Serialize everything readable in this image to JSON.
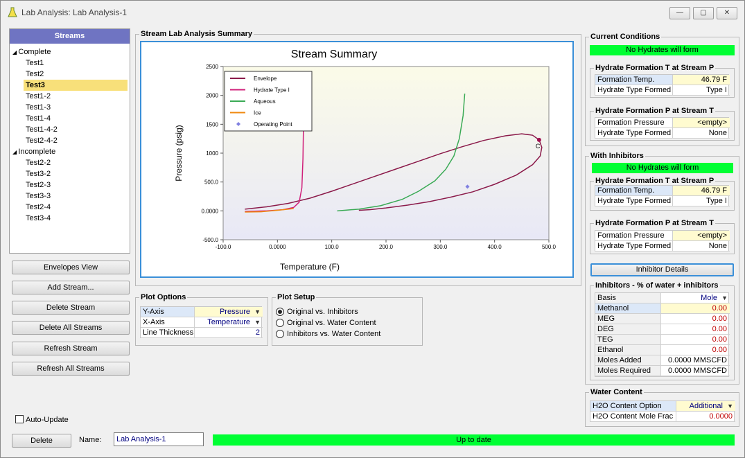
{
  "window": {
    "title": "Lab Analysis: Lab Analysis-1",
    "min_btn": "—",
    "max_btn": "▢",
    "close_btn": "✕"
  },
  "streams": {
    "header": "Streams",
    "groups": [
      {
        "label": "Complete",
        "items": [
          "Test1",
          "Test2",
          "Test3",
          "Test1-2",
          "Test1-3",
          "Test1-4",
          "Test1-4-2",
          "Test2-4-2"
        ]
      },
      {
        "label": "Incomplete",
        "items": [
          "Test2-2",
          "Test3-2",
          "Test2-3",
          "Test3-3",
          "Test2-4",
          "Test3-4"
        ]
      }
    ],
    "selected": "Test3"
  },
  "buttons": {
    "envelopes_view": "Envelopes View",
    "add_stream": "Add Stream...",
    "delete_stream": "Delete Stream",
    "delete_all_streams": "Delete All Streams",
    "refresh_stream": "Refresh Stream",
    "refresh_all_streams": "Refresh All Streams",
    "delete": "Delete",
    "inhibitor_details": "Inhibitor Details"
  },
  "auto_update": {
    "label": "Auto-Update",
    "checked": false
  },
  "name_field": {
    "label": "Name:",
    "value": "Lab Analysis-1"
  },
  "status_bar": "Up to date",
  "summary": {
    "group_title": "Stream Lab Analysis Summary"
  },
  "chart_data": {
    "type": "line",
    "title": "Stream Summary",
    "xlabel": "Temperature (F)",
    "ylabel": "Pressure (psig)",
    "xlim": [
      -100,
      500
    ],
    "ylim": [
      -500,
      2500
    ],
    "x_ticks": [
      "-100.0",
      "0.0000",
      "100.0",
      "200.0",
      "300.0",
      "400.0",
      "500.0"
    ],
    "y_ticks": [
      "-500.0",
      "0.0000",
      "500.0",
      "1000",
      "1500",
      "2000",
      "2500"
    ],
    "legend_position": "top-left",
    "series": [
      {
        "name": "Envelope",
        "color": "#8b1a4a",
        "x": [
          -60,
          -20,
          20,
          60,
          100,
          140,
          180,
          220,
          260,
          300,
          340,
          380,
          420,
          450,
          470,
          482,
          487,
          484,
          470,
          440,
          400,
          360,
          320,
          280,
          240,
          200,
          170,
          150
        ],
        "y": [
          30,
          70,
          130,
          220,
          340,
          470,
          600,
          730,
          860,
          990,
          1110,
          1220,
          1300,
          1335,
          1310,
          1230,
          1100,
          950,
          800,
          620,
          460,
          330,
          240,
          160,
          100,
          50,
          20,
          10
        ]
      },
      {
        "name": "Hydrate Type I",
        "color": "#d0207a",
        "x": [
          -60,
          -20,
          10,
          30,
          40,
          45,
          47,
          48,
          49
        ],
        "y": [
          -10,
          0,
          20,
          60,
          150,
          400,
          900,
          1500,
          2000
        ]
      },
      {
        "name": "Aqueous",
        "color": "#3aaa55",
        "x": [
          110,
          150,
          190,
          230,
          260,
          290,
          310,
          325,
          335,
          342,
          345
        ],
        "y": [
          0,
          30,
          90,
          200,
          340,
          520,
          720,
          950,
          1250,
          1650,
          2030
        ]
      },
      {
        "name": "Ice",
        "color": "#f08a10",
        "x": [
          -60,
          -30,
          0,
          20,
          30
        ],
        "y": [
          -20,
          -15,
          10,
          30,
          40
        ]
      },
      {
        "name": "Operating Point",
        "color": "#8080e0",
        "marker": "diamond",
        "x": [
          350
        ],
        "y": [
          420
        ]
      }
    ],
    "annotation": "C"
  },
  "plot_options": {
    "title": "Plot Options",
    "rows": [
      {
        "label": "Y-Axis",
        "value": "Pressure",
        "dropdown": true
      },
      {
        "label": "X-Axis",
        "value": "Temperature",
        "dropdown": true
      },
      {
        "label": "Line Thickness",
        "value": "2",
        "dropdown": false
      }
    ]
  },
  "plot_setup": {
    "title": "Plot Setup",
    "options": [
      "Original vs. Inhibitors",
      "Original vs. Water Content",
      "Inhibitors vs. Water Content"
    ],
    "selected": 0
  },
  "current_conditions": {
    "title": "Current Conditions",
    "status": "No Hydrates will form",
    "hft_title": "Hydrate Formation T at Stream P",
    "hft_rows": [
      {
        "label": "Formation Temp.",
        "value": "46.79 F"
      },
      {
        "label": "Hydrate Type Formed",
        "value": "Type I"
      }
    ],
    "hfp_title": "Hydrate Formation P at Stream T",
    "hfp_rows": [
      {
        "label": "Formation Pressure",
        "value": "<empty>"
      },
      {
        "label": "Hydrate Type Formed",
        "value": "None"
      }
    ]
  },
  "with_inhibitors": {
    "title": "With Inhibitors",
    "status": "No Hydrates will form",
    "hft_title": "Hydrate Formation T at Stream P",
    "hft_rows": [
      {
        "label": "Formation Temp.",
        "value": "46.79 F"
      },
      {
        "label": "Hydrate Type Formed",
        "value": "Type I"
      }
    ],
    "hfp_title": "Hydrate Formation P at Stream T",
    "hfp_rows": [
      {
        "label": "Formation Pressure",
        "value": "<empty>"
      },
      {
        "label": "Hydrate Type Formed",
        "value": "None"
      }
    ]
  },
  "inhibitors": {
    "title": "Inhibitors - % of water + inhibitors",
    "basis_label": "Basis",
    "basis_value": "Mole",
    "rows": [
      {
        "label": "Methanol",
        "value": "0.00"
      },
      {
        "label": "MEG",
        "value": "0.00"
      },
      {
        "label": "DEG",
        "value": "0.00"
      },
      {
        "label": "TEG",
        "value": "0.00"
      },
      {
        "label": "Ethanol",
        "value": "0.00"
      }
    ],
    "moles_added_label": "Moles Added",
    "moles_added_value": "0.0000 MMSCFD",
    "moles_required_label": "Moles Required",
    "moles_required_value": "0.0000 MMSCFD"
  },
  "water_content": {
    "title": "Water Content",
    "option_label": "H2O Content Option",
    "option_value": "Additional",
    "frac_label": "H2O Content Mole Frac",
    "frac_value": "0.0000"
  }
}
